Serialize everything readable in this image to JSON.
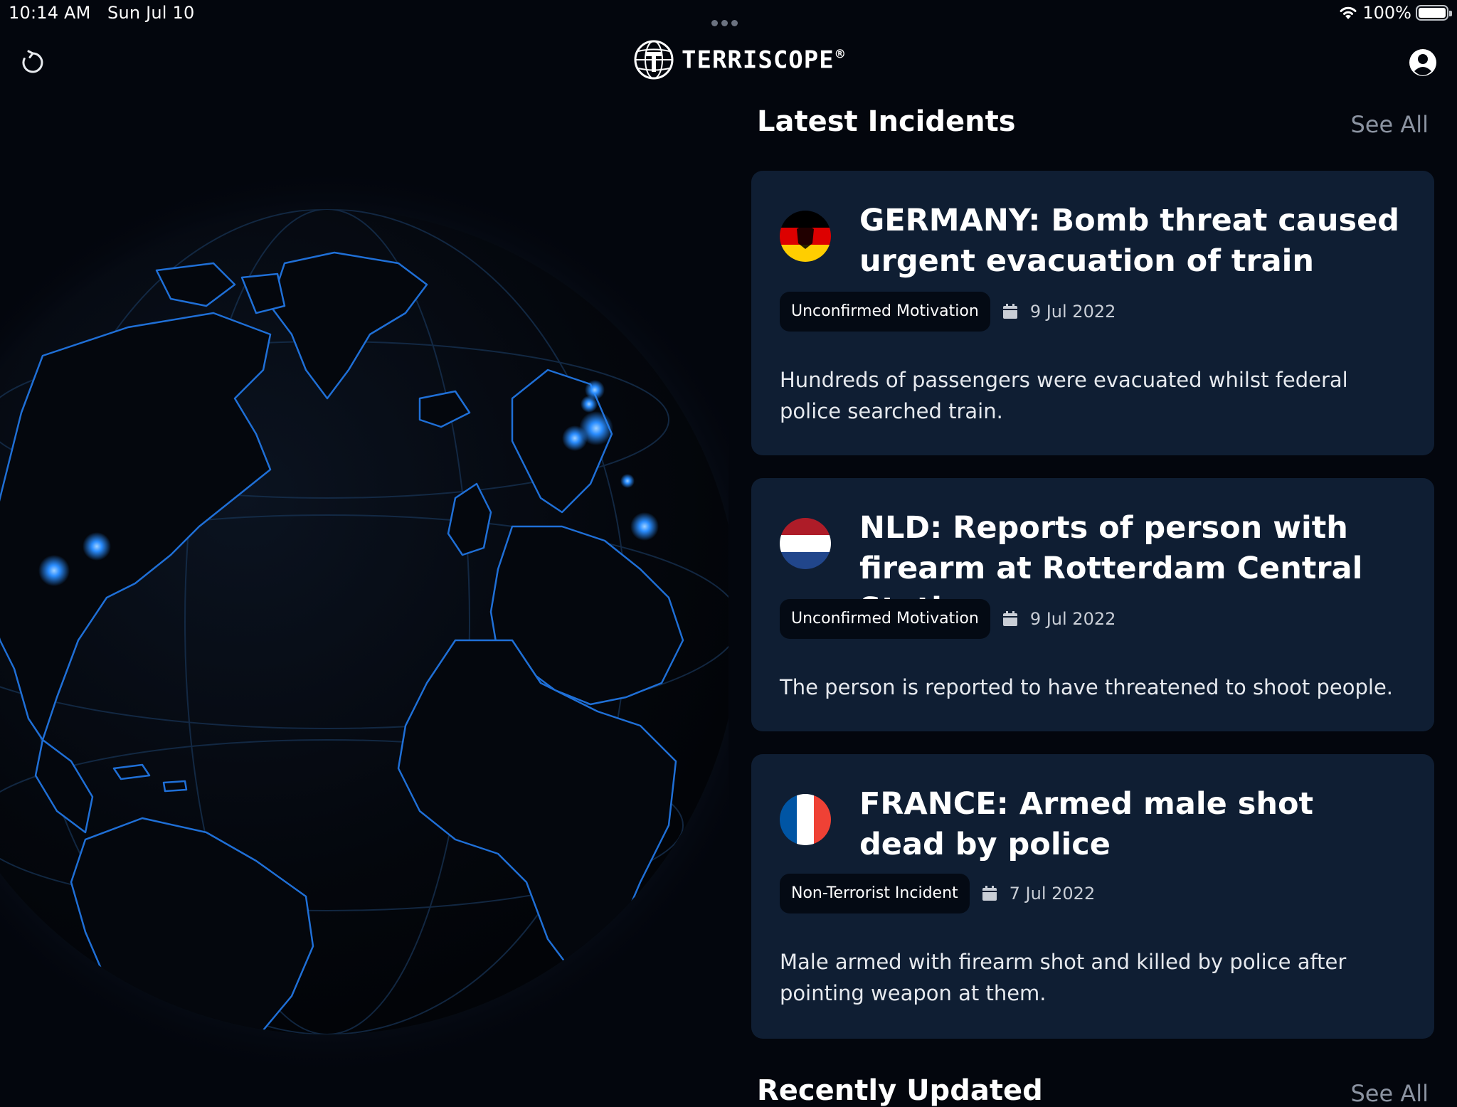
{
  "status": {
    "time": "10:14 AM",
    "date": "Sun Jul 10",
    "battery_pct": "100%"
  },
  "header": {
    "brand": "TERRISCOPE",
    "brand_mark": "®"
  },
  "latest": {
    "title": "Latest Incidents",
    "see_all": "See All",
    "incidents": [
      {
        "flag": "germany-flag-icon",
        "title": "GERMANY: Bomb threat caused urgent evacuation of train",
        "tag": "Unconfirmed Motivation",
        "date": "9 Jul 2022",
        "description": "Hundreds of passengers were evacuated whilst federal police searched train."
      },
      {
        "flag": "netherlands-flag-icon",
        "title": "NLD: Reports of person with firearm at Rotterdam Central Station",
        "tag": "Unconfirmed Motivation",
        "date": "9 Jul 2022",
        "description": "The person is reported to have threatened to shoot people."
      },
      {
        "flag": "france-flag-icon",
        "title": "FRANCE: Armed male shot dead by police",
        "tag": "Non-Terrorist Incident",
        "date": "7 Jul 2022",
        "description": "Male armed with firearm shot and killed by police after pointing weapon at them."
      }
    ]
  },
  "recent": {
    "title": "Recently Updated",
    "see_all": "See All"
  },
  "colors": {
    "background": "#03060d",
    "card": "#0f1e33",
    "tag_bg": "#040a14",
    "coastline": "#1f6fd6",
    "hotspot": "#2a8dff"
  }
}
